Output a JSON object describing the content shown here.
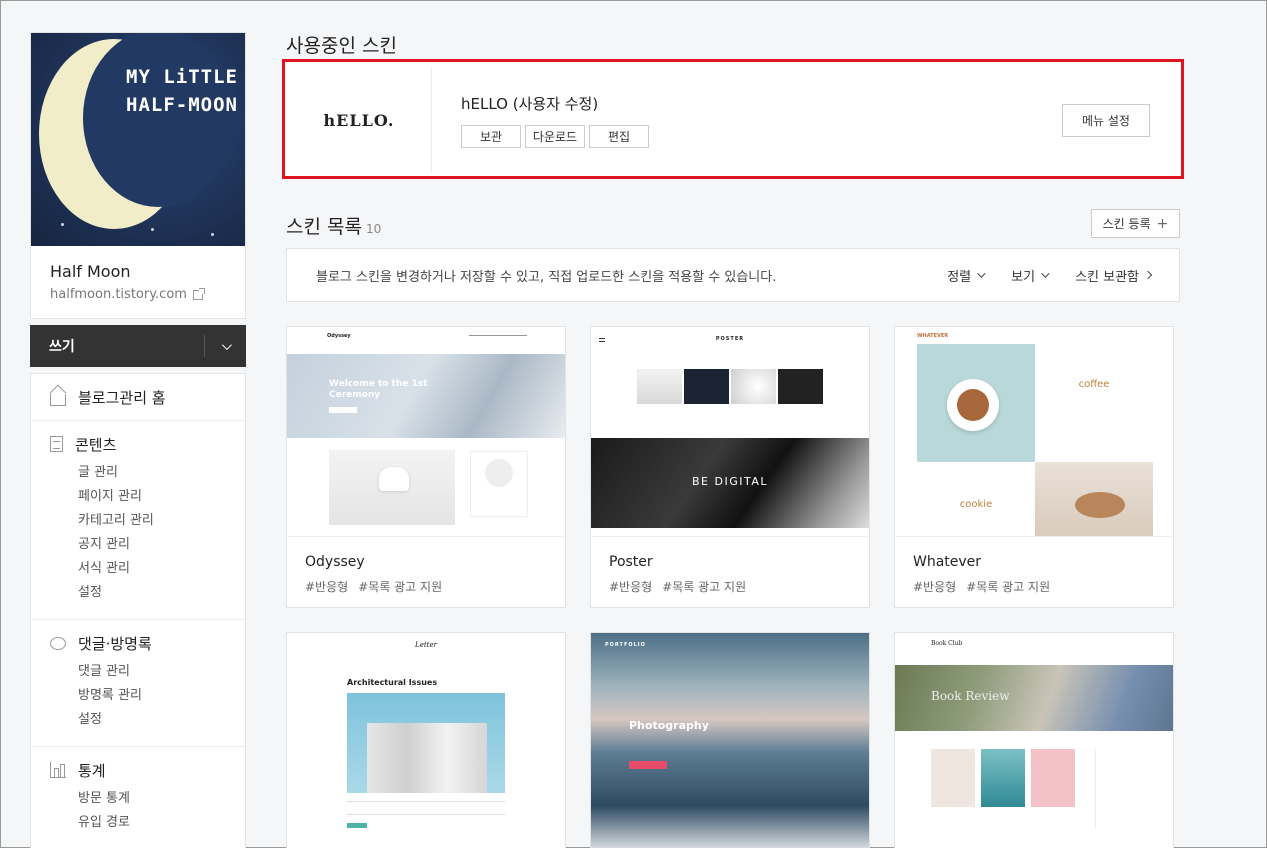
{
  "sidebar": {
    "cover_text": "MY LiTTLE HALF-MOON",
    "blog_name": "Half Moon",
    "blog_url": "halfmoon.tistory.com",
    "write_label": "쓰기",
    "home": "블로그관리 홈",
    "sections": [
      {
        "title": "콘텐츠",
        "icon": "document-icon",
        "items": [
          "글 관리",
          "페이지 관리",
          "카테고리 관리",
          "공지 관리",
          "서식 관리",
          "설정"
        ]
      },
      {
        "title": "댓글·방명록",
        "icon": "comment-icon",
        "items": [
          "댓글 관리",
          "방명록 관리",
          "설정"
        ]
      },
      {
        "title": "통계",
        "icon": "chart-icon",
        "items": [
          "방문 통계",
          "유입 경로"
        ]
      }
    ]
  },
  "current": {
    "heading": "사용중인 스킨",
    "logo": "hELLO.",
    "skin_name": "hELLO (사용자 수정)",
    "buttons": [
      "보관",
      "다운로드",
      "편집"
    ],
    "menu_button": "메뉴 설정"
  },
  "list": {
    "heading": "스킨 목록",
    "count": "10",
    "register_button": "스킨 등록",
    "description": "블로그 스킨을 변경하거나 저장할 수 있고, 직접 업로드한 스킨을 적용할 수 있습니다.",
    "sort": "정렬",
    "view": "보기",
    "storage": "스킨 보관함"
  },
  "skins": [
    {
      "name": "Odyssey",
      "tags": [
        "#반응형",
        "#목록 광고 지원"
      ],
      "preview_title": "Welcome to the 1st Ceremony",
      "logo": "Odyssey"
    },
    {
      "name": "Poster",
      "tags": [
        "#반응형",
        "#목록 광고 지원"
      ],
      "preview_title": "BE DIGITAL",
      "logo": "POSTER"
    },
    {
      "name": "Whatever",
      "tags": [
        "#반응형",
        "#목록 광고 지원"
      ],
      "preview_title": "coffee",
      "preview_sub": "cookie",
      "logo": "WHATEVER"
    },
    {
      "name": "Letter",
      "preview_title": "Architectural Issues",
      "logo": "Letter"
    },
    {
      "name": "Portfolio",
      "preview_title": "Photography",
      "logo": "PORTFOLIO"
    },
    {
      "name": "Book Club",
      "preview_title": "Book Review",
      "logo": "Book Club"
    }
  ]
}
